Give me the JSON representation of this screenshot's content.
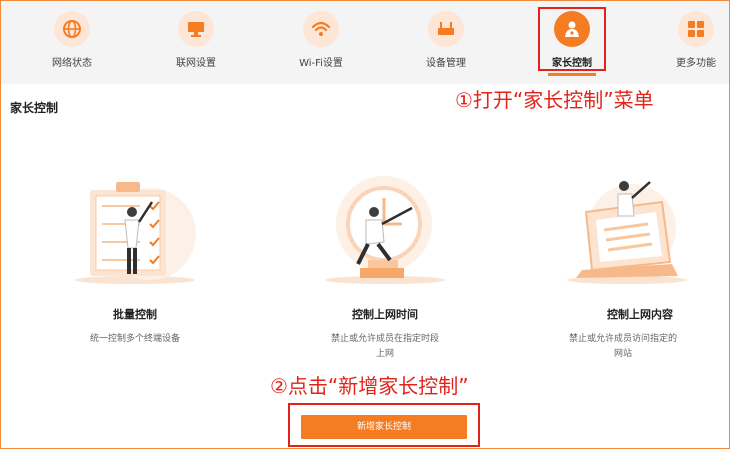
{
  "nav": {
    "items": [
      {
        "label": "网络状态",
        "icon": "globe-icon"
      },
      {
        "label": "联网设置",
        "icon": "monitor-icon"
      },
      {
        "label": "Wi-Fi设置",
        "icon": "wifi-icon"
      },
      {
        "label": "设备管理",
        "icon": "router-icon"
      },
      {
        "label": "家长控制",
        "icon": "parental-icon",
        "active": true
      },
      {
        "label": "更多功能",
        "icon": "grid-icon"
      }
    ]
  },
  "page": {
    "title": "家长控制"
  },
  "annotations": {
    "step1": "①打开“家长控制”菜单",
    "step2": "②点击“新增家长控制”"
  },
  "cards": [
    {
      "title": "批量控制",
      "desc_line1": "统一控制多个终端设备",
      "desc_line2": "",
      "illustration": "checklist-illustration"
    },
    {
      "title": "控制上网时间",
      "desc_line1": "禁止或允许成员在指定时段",
      "desc_line2": "上网",
      "illustration": "clock-illustration"
    },
    {
      "title": "控制上网内容",
      "desc_line1": "禁止或允许成员访问指定的",
      "desc_line2": "网站",
      "illustration": "laptop-illustration"
    }
  ],
  "add_button": {
    "label": "新增家长控制"
  },
  "colors": {
    "accent": "#f47c22",
    "highlight": "#e2231a",
    "nav_bg": "#f4f4f4",
    "icon_bg": "#fde6d6"
  }
}
